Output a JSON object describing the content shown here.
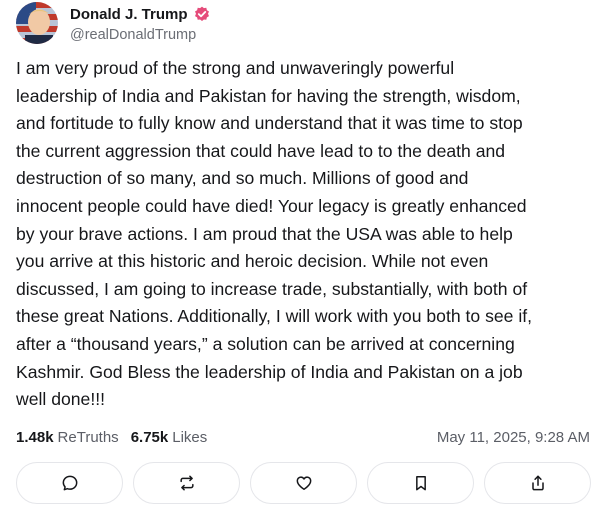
{
  "post": {
    "author": {
      "name": "Donald J. Trump",
      "handle": "@realDonaldTrump",
      "verified": true,
      "verified_color": "#e54b7a"
    },
    "lines": [
      "I am very proud of the strong and unwaveringly powerful",
      "leadership of India and Pakistan for having the strength, wisdom,",
      "and fortitude to fully know and understand that it was time to stop",
      "the current aggression that could have lead to to the death and",
      "destruction of so many, and so much. Millions of good and",
      "innocent people could have died! Your legacy is greatly enhanced",
      "by your brave actions. I am proud that the USA was able to help",
      "you arrive at this historic and heroic decision. While not even",
      "discussed, I am going to increase trade, substantially, with both of",
      "these great Nations. Additionally, I will work with you both to see if,",
      "after a “thousand years,” a solution can be arrived at concerning",
      "Kashmir. God Bless the leadership of India and Pakistan on a job",
      "well done!!!"
    ],
    "stats": {
      "retruths_count": "1.48k",
      "retruths_label": "ReTruths",
      "likes_count": "6.75k",
      "likes_label": "Likes",
      "date": "May 11, 2025, 9:28 AM"
    },
    "actions": [
      {
        "icon": "reply-icon"
      },
      {
        "icon": "retruth-icon"
      },
      {
        "icon": "like-icon"
      },
      {
        "icon": "bookmark-icon"
      },
      {
        "icon": "share-icon"
      }
    ]
  }
}
